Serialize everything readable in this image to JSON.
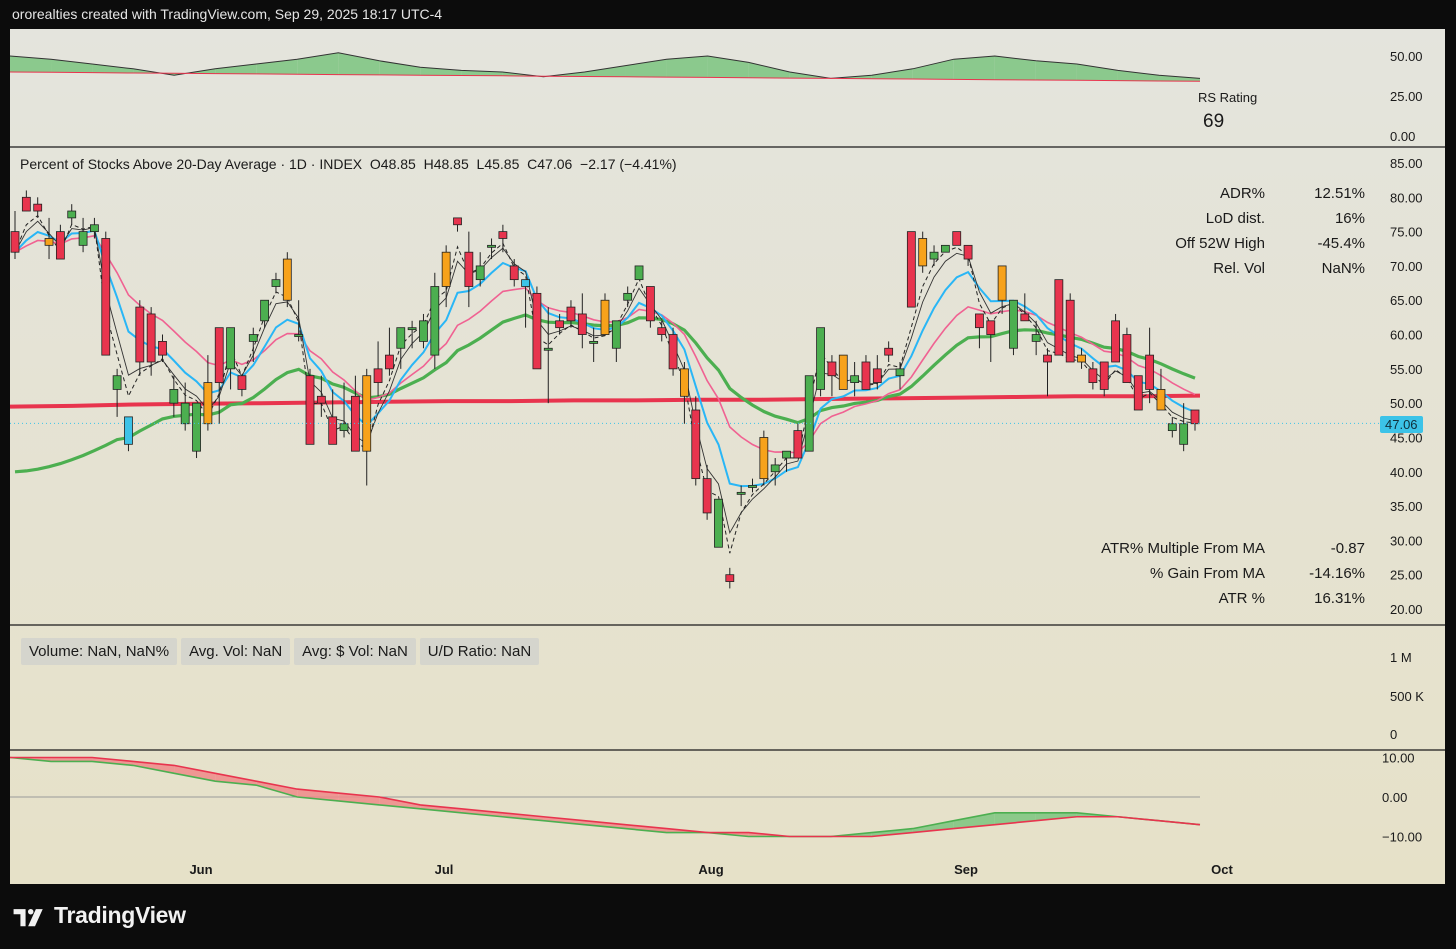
{
  "header": {
    "text": "ororealties created with TradingView.com, Sep 29, 2025 18:17 UTC-4"
  },
  "brand": {
    "name": "TradingView"
  },
  "rs_panel": {
    "label": "RS Rating",
    "value": "69",
    "ticks": [
      "50.00",
      "25.00",
      "0.00"
    ]
  },
  "main_panel": {
    "title": "Percent of Stocks Above 20-Day Average · 1D · INDEX  O48.85  H48.85  L45.85  C47.06  −2.17 (−4.41%)",
    "ticks": [
      "85.00",
      "80.00",
      "75.00",
      "70.00",
      "65.00",
      "60.00",
      "55.00",
      "50.00",
      "45.00",
      "40.00",
      "35.00",
      "30.00",
      "25.00",
      "20.00"
    ],
    "last_price": "47.06",
    "stats_top": [
      {
        "label": "ADR%",
        "value": "12.51%"
      },
      {
        "label": "LoD dist.",
        "value": "16%"
      },
      {
        "label": "Off 52W High",
        "value": "-45.4%"
      },
      {
        "label": "Rel. Vol",
        "value": "NaN%"
      }
    ],
    "stats_bottom": [
      {
        "label": "ATR% Multiple From MA",
        "value": "-0.87"
      },
      {
        "label": "% Gain From MA",
        "value": "-14.16%"
      },
      {
        "label": "ATR %",
        "value": "16.31%"
      }
    ]
  },
  "volume_panel": {
    "legend": [
      "Volume: NaN, NaN%",
      "Avg. Vol: NaN",
      "Avg: $ Vol: NaN",
      "U/D Ratio: NaN"
    ],
    "ticks": [
      "1 M",
      "500 K",
      "0"
    ]
  },
  "osc_panel": {
    "ticks": [
      "10.00",
      "0.00",
      "−10.00"
    ]
  },
  "x_axis": {
    "ticks": [
      "Jun",
      "Jul",
      "Aug",
      "Sep",
      "Oct"
    ]
  },
  "colors": {
    "up": "#4caf50",
    "down": "#e8344e",
    "accel_up": "#3cc3e8",
    "accel_down": "#f7a21b",
    "ma200": "#e8344e",
    "ma50": "#4caf50",
    "ema21": "#f06292",
    "ema10": "#29b6f6"
  },
  "chart_data": {
    "type": "candlestick",
    "ylim": [
      20,
      85
    ],
    "candles": [
      {
        "o": 75,
        "h": 78,
        "l": 71,
        "c": 72
      },
      {
        "o": 80,
        "h": 81,
        "l": 78,
        "c": 78
      },
      {
        "o": 79,
        "h": 80,
        "l": 77,
        "c": 78
      },
      {
        "o": 74,
        "h": 77,
        "l": 71,
        "c": 73
      },
      {
        "o": 75,
        "h": 76,
        "l": 71,
        "c": 71
      },
      {
        "o": 77,
        "h": 79,
        "l": 76,
        "c": 78
      },
      {
        "o": 73,
        "h": 77,
        "l": 72,
        "c": 75
      },
      {
        "o": 75,
        "h": 77,
        "l": 74,
        "c": 76
      },
      {
        "o": 74,
        "h": 75,
        "l": 57,
        "c": 57
      },
      {
        "o": 52,
        "h": 55,
        "l": 48,
        "c": 54
      },
      {
        "o": 44,
        "h": 48,
        "l": 43,
        "c": 48
      },
      {
        "o": 64,
        "h": 65,
        "l": 54,
        "c": 56
      },
      {
        "o": 63,
        "h": 64,
        "l": 54,
        "c": 56
      },
      {
        "o": 59,
        "h": 60,
        "l": 56,
        "c": 57
      },
      {
        "o": 50,
        "h": 54,
        "l": 48,
        "c": 52
      },
      {
        "o": 47,
        "h": 53,
        "l": 46,
        "c": 50
      },
      {
        "o": 43,
        "h": 50,
        "l": 42,
        "c": 50
      },
      {
        "o": 53,
        "h": 57,
        "l": 46,
        "c": 47
      },
      {
        "o": 61,
        "h": 61,
        "l": 47,
        "c": 53
      },
      {
        "o": 55,
        "h": 60,
        "l": 52,
        "c": 61
      },
      {
        "o": 54,
        "h": 54,
        "l": 51,
        "c": 52
      },
      {
        "o": 59,
        "h": 61,
        "l": 56,
        "c": 60
      },
      {
        "o": 62,
        "h": 65,
        "l": 61,
        "c": 65
      },
      {
        "o": 67,
        "h": 69,
        "l": 66,
        "c": 68
      },
      {
        "o": 71,
        "h": 72,
        "l": 64,
        "c": 65
      },
      {
        "o": 60,
        "h": 65,
        "l": 59,
        "c": 60
      },
      {
        "o": 54,
        "h": 55,
        "l": 44,
        "c": 44
      },
      {
        "o": 51,
        "h": 54,
        "l": 48,
        "c": 50
      },
      {
        "o": 48,
        "h": 52,
        "l": 44,
        "c": 44
      },
      {
        "o": 46,
        "h": 53,
        "l": 45,
        "c": 47
      },
      {
        "o": 51,
        "h": 54,
        "l": 43,
        "c": 43
      },
      {
        "o": 54,
        "h": 55,
        "l": 38,
        "c": 43
      },
      {
        "o": 55,
        "h": 59,
        "l": 51,
        "c": 53
      },
      {
        "o": 57,
        "h": 61,
        "l": 54,
        "c": 55
      },
      {
        "o": 58,
        "h": 60,
        "l": 55,
        "c": 61
      },
      {
        "o": 61,
        "h": 62,
        "l": 58,
        "c": 61
      },
      {
        "o": 59,
        "h": 63,
        "l": 58,
        "c": 62
      },
      {
        "o": 57,
        "h": 69,
        "l": 55,
        "c": 67
      },
      {
        "o": 72,
        "h": 73,
        "l": 64,
        "c": 67
      },
      {
        "o": 77,
        "h": 77,
        "l": 75,
        "c": 76
      },
      {
        "o": 72,
        "h": 75,
        "l": 64,
        "c": 67
      },
      {
        "o": 68,
        "h": 72,
        "l": 67,
        "c": 70
      },
      {
        "o": 73,
        "h": 74,
        "l": 71,
        "c": 73
      },
      {
        "o": 75,
        "h": 76,
        "l": 72,
        "c": 74
      },
      {
        "o": 70,
        "h": 71,
        "l": 67,
        "c": 68
      },
      {
        "o": 67,
        "h": 68,
        "l": 61,
        "c": 68
      },
      {
        "o": 66,
        "h": 67,
        "l": 55,
        "c": 55
      },
      {
        "o": 58,
        "h": 64,
        "l": 50,
        "c": 58
      },
      {
        "o": 62,
        "h": 63,
        "l": 60,
        "c": 61
      },
      {
        "o": 64,
        "h": 65,
        "l": 61,
        "c": 62
      },
      {
        "o": 63,
        "h": 66,
        "l": 58,
        "c": 60
      },
      {
        "o": 59,
        "h": 61,
        "l": 56,
        "c": 59
      },
      {
        "o": 65,
        "h": 66,
        "l": 60,
        "c": 60
      },
      {
        "o": 58,
        "h": 60,
        "l": 56,
        "c": 62
      },
      {
        "o": 65,
        "h": 67,
        "l": 64,
        "c": 66
      },
      {
        "o": 68,
        "h": 70,
        "l": 68,
        "c": 70
      },
      {
        "o": 67,
        "h": 67,
        "l": 61,
        "c": 62
      },
      {
        "o": 61,
        "h": 62,
        "l": 59,
        "c": 60
      },
      {
        "o": 60,
        "h": 61,
        "l": 54,
        "c": 55
      },
      {
        "o": 55,
        "h": 56,
        "l": 47,
        "c": 51
      },
      {
        "o": 49,
        "h": 51,
        "l": 38,
        "c": 39
      },
      {
        "o": 39,
        "h": 41,
        "l": 33,
        "c": 34
      },
      {
        "o": 29,
        "h": 36,
        "l": 29,
        "c": 36
      },
      {
        "o": 25,
        "h": 26,
        "l": 23,
        "c": 24
      },
      {
        "o": 37,
        "h": 38,
        "l": 35,
        "c": 37
      },
      {
        "o": 38,
        "h": 39,
        "l": 37,
        "c": 38
      },
      {
        "o": 45,
        "h": 46,
        "l": 38,
        "c": 39
      },
      {
        "o": 40,
        "h": 42,
        "l": 38,
        "c": 41
      },
      {
        "o": 42,
        "h": 43,
        "l": 40,
        "c": 43
      },
      {
        "o": 46,
        "h": 47,
        "l": 42,
        "c": 42
      },
      {
        "o": 43,
        "h": 54,
        "l": 43,
        "c": 54
      },
      {
        "o": 52,
        "h": 61,
        "l": 51,
        "c": 61
      },
      {
        "o": 56,
        "h": 57,
        "l": 51,
        "c": 54
      },
      {
        "o": 57,
        "h": 57,
        "l": 52,
        "c": 52
      },
      {
        "o": 53,
        "h": 56,
        "l": 51,
        "c": 54
      },
      {
        "o": 56,
        "h": 57,
        "l": 52,
        "c": 52
      },
      {
        "o": 55,
        "h": 57,
        "l": 52,
        "c": 53
      },
      {
        "o": 58,
        "h": 59,
        "l": 56,
        "c": 57
      },
      {
        "o": 54,
        "h": 56,
        "l": 52,
        "c": 55
      },
      {
        "o": 75,
        "h": 75,
        "l": 64,
        "c": 64
      },
      {
        "o": 74,
        "h": 75,
        "l": 69,
        "c": 70
      },
      {
        "o": 71,
        "h": 73,
        "l": 70,
        "c": 72
      },
      {
        "o": 72,
        "h": 73,
        "l": 72,
        "c": 73
      },
      {
        "o": 75,
        "h": 75,
        "l": 73,
        "c": 73
      },
      {
        "o": 73,
        "h": 73,
        "l": 70,
        "c": 71
      },
      {
        "o": 63,
        "h": 63,
        "l": 58,
        "c": 61
      },
      {
        "o": 62,
        "h": 62,
        "l": 56,
        "c": 60
      },
      {
        "o": 70,
        "h": 70,
        "l": 63,
        "c": 65
      },
      {
        "o": 58,
        "h": 65,
        "l": 57,
        "c": 65
      },
      {
        "o": 63,
        "h": 66,
        "l": 62,
        "c": 62
      },
      {
        "o": 59,
        "h": 62,
        "l": 57,
        "c": 60
      },
      {
        "o": 57,
        "h": 58,
        "l": 51,
        "c": 56
      },
      {
        "o": 68,
        "h": 68,
        "l": 57,
        "c": 57
      },
      {
        "o": 65,
        "h": 66,
        "l": 56,
        "c": 56
      },
      {
        "o": 57,
        "h": 58,
        "l": 55,
        "c": 56
      },
      {
        "o": 55,
        "h": 56,
        "l": 52,
        "c": 53
      },
      {
        "o": 56,
        "h": 56,
        "l": 51,
        "c": 52
      },
      {
        "o": 62,
        "h": 63,
        "l": 56,
        "c": 56
      },
      {
        "o": 60,
        "h": 61,
        "l": 53,
        "c": 53
      },
      {
        "o": 54,
        "h": 54,
        "l": 49,
        "c": 49
      },
      {
        "o": 57,
        "h": 61,
        "l": 50,
        "c": 52
      },
      {
        "o": 52,
        "h": 55,
        "l": 49,
        "c": 49
      },
      {
        "o": 46,
        "h": 48,
        "l": 45,
        "c": 47
      },
      {
        "o": 44,
        "h": 50,
        "l": 43,
        "c": 47
      },
      {
        "o": 49,
        "h": 49,
        "l": 46,
        "c": 47
      }
    ],
    "ma200": [
      49.5,
      49.6,
      49.8,
      49.9,
      50,
      50.1,
      50.2,
      50.3,
      50.3,
      50.4,
      50.4,
      50.5,
      50.5,
      50.6,
      50.7,
      50.8,
      50.9,
      51,
      51,
      51.1
    ],
    "rs_line": [
      50,
      48,
      45,
      42,
      38,
      42,
      45,
      48,
      52,
      47,
      43,
      41,
      40,
      37,
      40,
      44,
      48,
      50,
      46,
      40,
      36,
      38,
      42,
      48,
      50,
      47,
      45,
      41,
      38,
      36
    ],
    "osc_fast": [
      10,
      9,
      9,
      8,
      6,
      4,
      3,
      0,
      -1,
      -2,
      -3,
      -4,
      -5,
      -6,
      -7,
      -8,
      -9,
      -9,
      -10,
      -10,
      -10,
      -9,
      -8,
      -6,
      -4,
      -4,
      -4,
      -5,
      -6,
      -7
    ],
    "osc_slow": [
      10,
      10,
      10,
      9,
      8,
      6,
      4,
      2,
      1,
      0,
      -2,
      -3,
      -4,
      -5,
      -6,
      -7,
      -8,
      -9,
      -9,
      -10,
      -10,
      -10,
      -9,
      -8,
      -7,
      -6,
      -5,
      -5,
      -6,
      -7
    ]
  }
}
